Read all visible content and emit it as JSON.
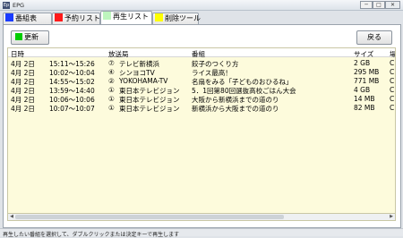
{
  "window": {
    "title": "EPG",
    "app_icon": "Ep",
    "min": "─",
    "max": "□",
    "close": "✕"
  },
  "tabs": [
    {
      "label": "番組表",
      "color": "#1a3cff"
    },
    {
      "label": "予約リスト",
      "color": "#ff1a1a"
    },
    {
      "label": "再生リスト",
      "color": "#bdf5bd"
    },
    {
      "label": "削除ツール",
      "color": "#ffff00"
    }
  ],
  "toolbar": {
    "refresh_label": "更新",
    "refresh_color": "#00cc00",
    "back_label": "戻る"
  },
  "list": {
    "headers": {
      "date": "日時",
      "channel": "放送局",
      "title": "番組",
      "size": "サイズ",
      "format": "場"
    },
    "rows": [
      {
        "date": "4月 2日",
        "time": "15:11～15:26",
        "ch_num": "⑦",
        "channel": "テレビ新横浜",
        "badge": "",
        "title": "餃子のつくり方",
        "size": "2 GB",
        "fmt": "C"
      },
      {
        "date": "4月 2日",
        "time": "10:02～10:04",
        "ch_num": "④",
        "channel": "シンヨコTV",
        "badge": "",
        "title": "ライス最高！",
        "size": "295 MB",
        "fmt": "C"
      },
      {
        "date": "4月 2日",
        "time": "14:55～15:02",
        "ch_num": "②",
        "channel": "YOKOHAMA-TV",
        "badge": "",
        "title": "名扇をみる「子どものおひるね」",
        "size": "771 MB",
        "fmt": "C"
      },
      {
        "date": "4月 2日",
        "time": "13:59～14:40",
        "ch_num": "①",
        "channel": "東日本テレビジョン",
        "badge": "",
        "title": "5．1回第80回選抜高校ごはん大会",
        "size": "4 GB",
        "fmt": "C"
      },
      {
        "date": "4月 2日",
        "time": "10:06～10:06",
        "ch_num": "①",
        "channel": "東日本テレビジョン",
        "badge": "",
        "title": "大阪から新横浜までの道のり",
        "size": "14 MB",
        "fmt": "C"
      },
      {
        "date": "4月 2日",
        "time": "10:07～10:07",
        "ch_num": "①",
        "channel": "東日本テレビジョン",
        "badge": "",
        "title": "新横浜から大阪までの道のり",
        "size": "82 MB",
        "fmt": "C"
      }
    ]
  },
  "status": {
    "text": "再生したい番組を選択して、ダブルクリックまたは決定キーで再生します"
  }
}
